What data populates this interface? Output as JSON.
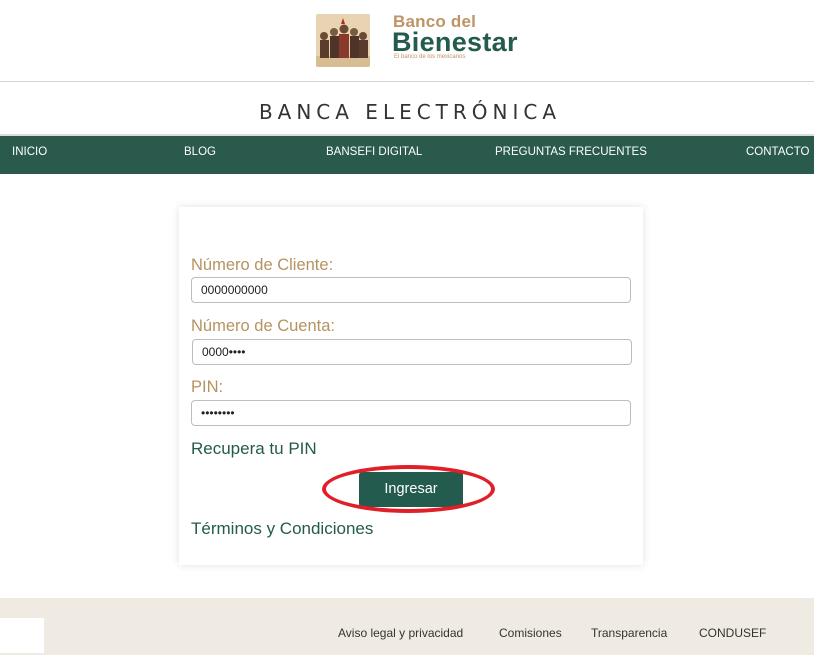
{
  "header": {
    "logo_line1": "Banco del",
    "logo_line2": "Bienestar",
    "logo_tagline": "El banco de los mexicanos",
    "subtitle": "BANCA ELECTRÓNICA"
  },
  "nav": {
    "items": [
      "INICIO",
      "BLOG",
      "BANSEFI DIGITAL",
      "PREGUNTAS FRECUENTES",
      "CONTACTO"
    ]
  },
  "form": {
    "cliente_label": "Número de Cliente:",
    "cliente_value": "0000000000",
    "cuenta_label": "Número de Cuenta:",
    "cuenta_value": "0000••••",
    "pin_label": "PIN:",
    "pin_value": "••••••••",
    "recover_link": "Recupera tu PIN",
    "submit_label": "Ingresar",
    "terms_link": "Términos y Condiciones"
  },
  "footer": {
    "links": [
      "Aviso legal y privacidad",
      "Comisiones",
      "Transparencia",
      "CONDUSEF"
    ]
  },
  "colors": {
    "brand_green": "#235b4e",
    "nav_green": "#295a4c",
    "gold": "#bd9466",
    "highlight_red": "#e01f28",
    "footer_bg": "#efebe3"
  }
}
